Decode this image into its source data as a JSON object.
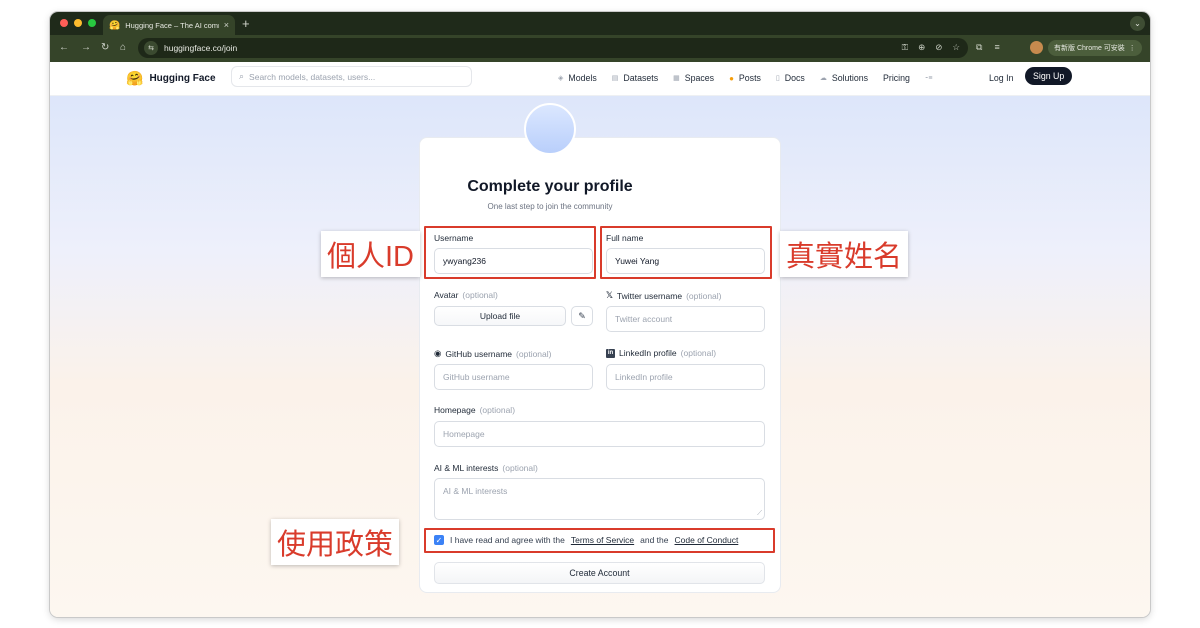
{
  "browser": {
    "tab_title": "Hugging Face – The AI comm",
    "tab_favicon": "🤗",
    "tab_close": "×",
    "new_tab": "+",
    "url": "huggingface.co/join",
    "update_label": "有新版 Chrome 可安裝",
    "update_menu": "⋮",
    "traffic_lights": [
      "#ff5f57",
      "#febc2e",
      "#28c840"
    ]
  },
  "site": {
    "logo_text": "Hugging Face",
    "logo_emoji": "🤗",
    "search_placeholder": "Search models, datasets, users...",
    "nav": [
      {
        "label": "Models",
        "icon": "models-icon"
      },
      {
        "label": "Datasets",
        "icon": "datasets-icon"
      },
      {
        "label": "Spaces",
        "icon": "spaces-icon"
      },
      {
        "label": "Posts",
        "icon": "posts-icon"
      },
      {
        "label": "Docs",
        "icon": "docs-icon"
      },
      {
        "label": "Solutions",
        "icon": "solutions-icon"
      },
      {
        "label": "Pricing",
        "icon": ""
      }
    ],
    "login": "Log In",
    "signup": "Sign Up"
  },
  "form": {
    "title": "Complete your profile",
    "subtitle": "One last step to join the community",
    "username": {
      "label": "Username",
      "value": "ywyang236"
    },
    "fullname": {
      "label": "Full name",
      "value": "Yuwei Yang"
    },
    "avatar": {
      "label": "Avatar",
      "optional": "(optional)",
      "button": "Upload file"
    },
    "twitter": {
      "label": "Twitter username",
      "optional": "(optional)",
      "placeholder": "Twitter account"
    },
    "github": {
      "label": "GitHub username",
      "optional": "(optional)",
      "placeholder": "GitHub username"
    },
    "linkedin": {
      "label": "LinkedIn profile",
      "optional": "(optional)",
      "placeholder": "LinkedIn profile"
    },
    "homepage": {
      "label": "Homepage",
      "optional": "(optional)",
      "placeholder": "Homepage"
    },
    "interests": {
      "label": "AI & ML interests",
      "optional": "(optional)",
      "placeholder": "AI & ML interests"
    },
    "terms": {
      "prefix": "I have read and agree with the",
      "tos": "Terms of Service",
      "mid": "and the",
      "coc": "Code of Conduct",
      "checked": true
    },
    "create_button": "Create Account"
  },
  "annotations": {
    "personal_id": "個人ID",
    "real_name": "真實姓名",
    "usage_policy": "使用政策",
    "color": "#d93b2b"
  }
}
